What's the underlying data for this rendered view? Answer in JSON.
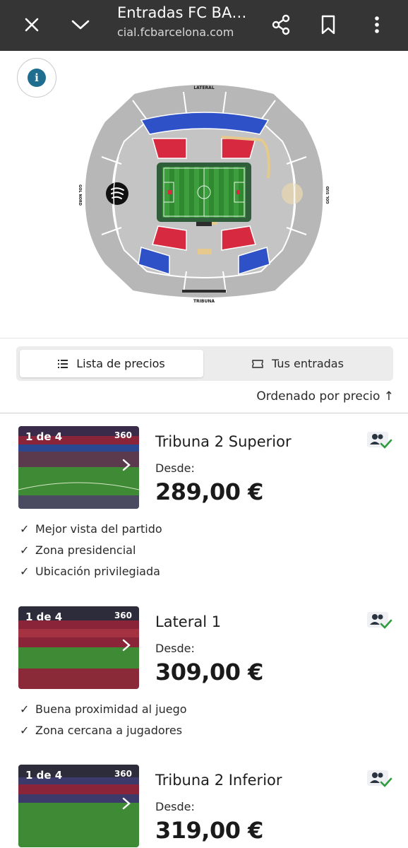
{
  "browser": {
    "title": "Entradas FC BA…",
    "url": "cial.fcbarcelona.com"
  },
  "map": {
    "labels": {
      "lateral": "LATERAL",
      "tribuna": "TRIBUNA",
      "gol_nord": "GOL NORD",
      "gol_sud": "GOL SUD"
    },
    "colors": {
      "blue": "#2e51c8",
      "red": "#d72a40",
      "grey": "#b9b9b9",
      "pitch": "#3f9a3f"
    }
  },
  "tabs": {
    "active_label": "Lista de precios",
    "inactive_label": "Tus entradas"
  },
  "sort": {
    "label": "Ordenado por precio ↑"
  },
  "tickets": [
    {
      "photo_count": "1 de 4",
      "view_360": "360",
      "name": "Tribuna 2 Superior",
      "desde": "Desde:",
      "price": "289,00 €",
      "features": [
        "Mejor vista del partido",
        "Zona presidencial",
        "Ubicación privilegiada"
      ]
    },
    {
      "photo_count": "1 de 4",
      "view_360": "360",
      "name": "Lateral 1",
      "desde": "Desde:",
      "price": "309,00 €",
      "features": [
        "Buena proximidad al juego",
        "Zona cercana a jugadores"
      ]
    },
    {
      "photo_count": "1 de 4",
      "view_360": "360",
      "name": "Tribuna 2 Inferior",
      "desde": "Desde:",
      "price": "319,00 €",
      "features": []
    }
  ]
}
